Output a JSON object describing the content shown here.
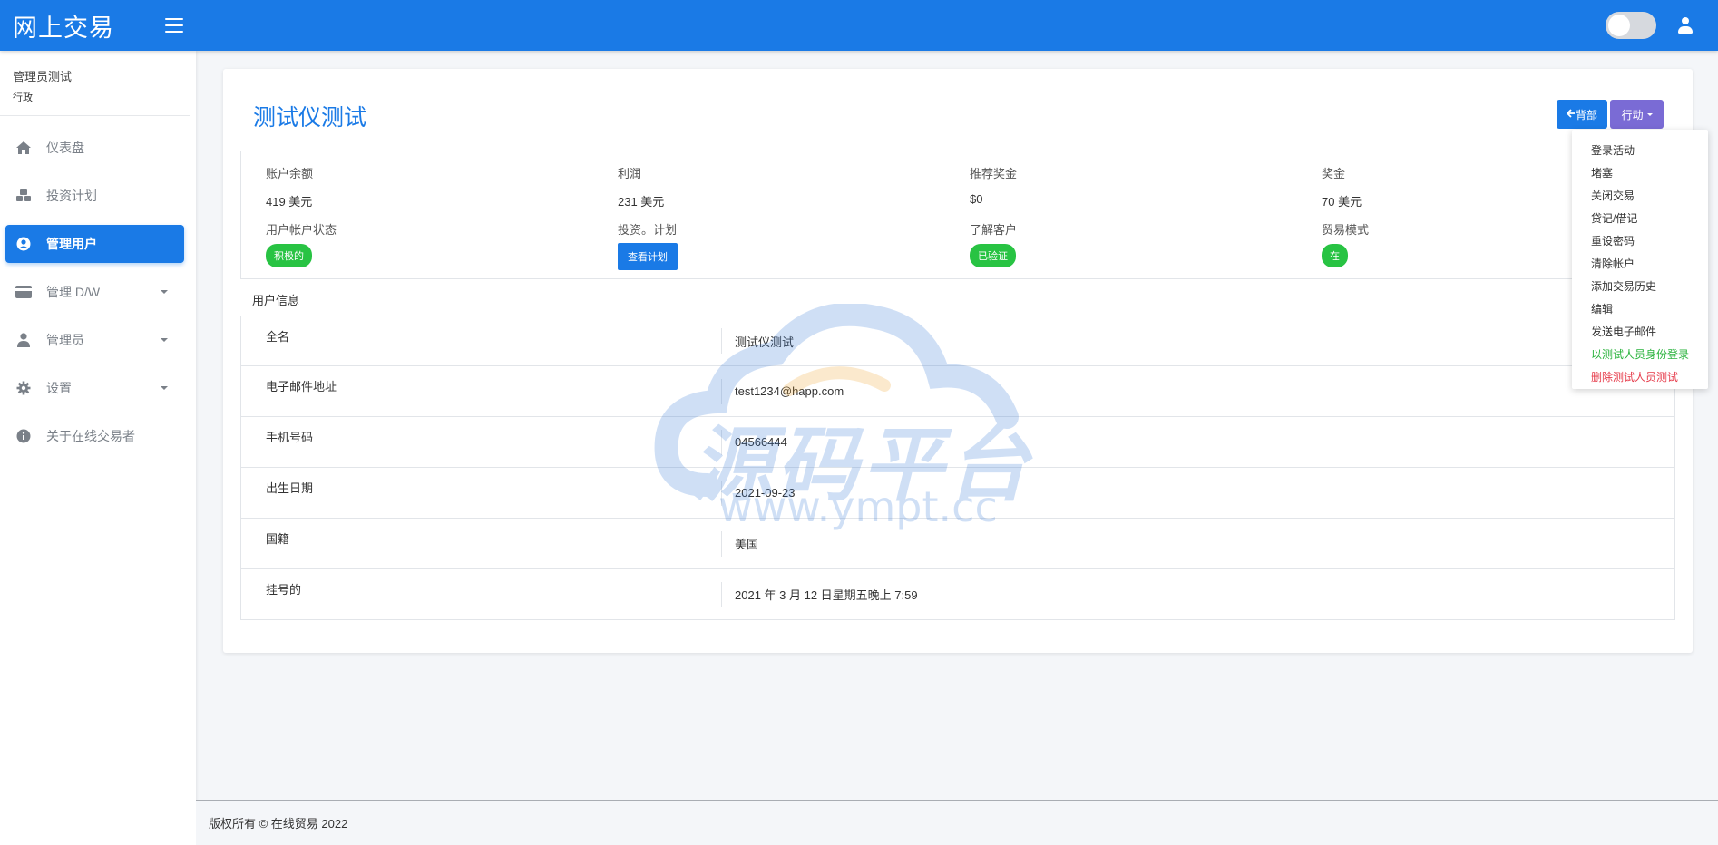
{
  "app": {
    "brand": "网上交易"
  },
  "sidebar": {
    "profile": {
      "name": "管理员测试",
      "role": "行政"
    },
    "items": [
      {
        "label": "仪表盘",
        "icon": "home-icon"
      },
      {
        "label": "投资计划",
        "icon": "cubes-icon"
      },
      {
        "label": "管理用户",
        "icon": "user-circle-icon",
        "active": true
      },
      {
        "label": "管理 D/W",
        "icon": "credit-card-icon"
      },
      {
        "label": "管理员",
        "icon": "user-icon"
      },
      {
        "label": "设置",
        "icon": "gear-icon"
      },
      {
        "label": "关于在线交易者",
        "icon": "info-icon"
      }
    ]
  },
  "main": {
    "title": "测试仪测试",
    "back_label": "背部",
    "action_label": "行动",
    "stats": {
      "balance": {
        "label": "账户余额",
        "value": "419 美元"
      },
      "profit": {
        "label": "利润",
        "value": "231 美元"
      },
      "referral": {
        "label": "推荐奖金",
        "value": "$0"
      },
      "bonus": {
        "label": "奖金",
        "value": "70 美元"
      },
      "status": {
        "label": "用户帐户状态",
        "value": "积极的"
      },
      "plans": {
        "label": "投资。计划",
        "button": "查看计划"
      },
      "kyc": {
        "label": "了解客户",
        "value": "已验证"
      },
      "trade_mode": {
        "label": "贸易模式",
        "value": "在"
      }
    },
    "section_label": "用户信息",
    "info": [
      {
        "key": "全名",
        "value": "测试仪测试"
      },
      {
        "key": "电子邮件地址",
        "value": "test1234@happ.com"
      },
      {
        "key": "手机号码",
        "value": "04566444"
      },
      {
        "key": "出生日期",
        "value": "2021-09-23"
      },
      {
        "key": "国籍",
        "value": "美国"
      },
      {
        "key": "挂号的",
        "value": "2021 年 3 月 12 日星期五晚上 7:59"
      }
    ]
  },
  "dropdown": [
    "登录活动",
    "堵塞",
    "关闭交易",
    "贷记/借记",
    "重设密码",
    "清除帐户",
    "添加交易历史",
    "编辑",
    "发送电子邮件",
    "以测试人员身份登录",
    "删除测试人员测试"
  ],
  "watermark": {
    "text": "源码平台",
    "url": "www.ympt.cc"
  },
  "footer": {
    "text": "版权所有 © 在线贸易 2022"
  },
  "colors": {
    "primary": "#1a7ae6",
    "action": "#7a6bd5",
    "success": "#28c343",
    "danger": "#e63c4b"
  }
}
